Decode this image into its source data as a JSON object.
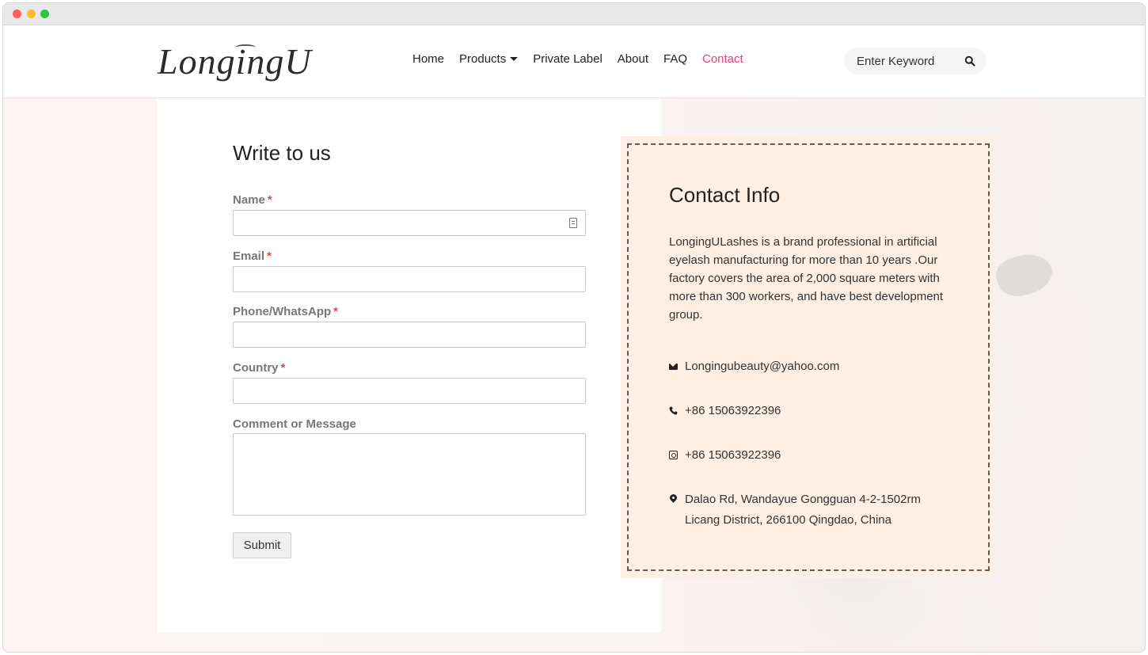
{
  "logo": {
    "text": "LongingU"
  },
  "nav": {
    "items": [
      {
        "label": "Home"
      },
      {
        "label": "Products"
      },
      {
        "label": "Private Label"
      },
      {
        "label": "About"
      },
      {
        "label": "FAQ"
      },
      {
        "label": "Contact"
      }
    ],
    "active": "Contact",
    "active_color": "#e4407b"
  },
  "search": {
    "placeholder": "Enter Keyword"
  },
  "form": {
    "title": "Write to us",
    "fields": [
      {
        "label": "Name",
        "required_mark": "*"
      },
      {
        "label": "Email",
        "required_mark": "*"
      },
      {
        "label": "Phone/WhatsApp",
        "required_mark": "*"
      },
      {
        "label": "Country",
        "required_mark": "*"
      },
      {
        "label": "Comment or Message"
      }
    ],
    "submit_label": "Submit"
  },
  "contact": {
    "title": "Contact Info",
    "description": "LongingULashes is a brand professional in artificial eyelash manufacturing for more than 10 years .Our factory covers the area of 2,000 square meters with more than 300 workers, and have best development group.",
    "email": "Longingubeauty@yahoo.com",
    "phone": "+86 15063922396",
    "whatsapp": "+86 15063922396",
    "address_line1": "Dalao Rd, Wandayue Gongguan 4-2-1502rm",
    "address_line2": "Licang District, 266100 Qingdao, China",
    "card_color": "#fdefe3"
  }
}
